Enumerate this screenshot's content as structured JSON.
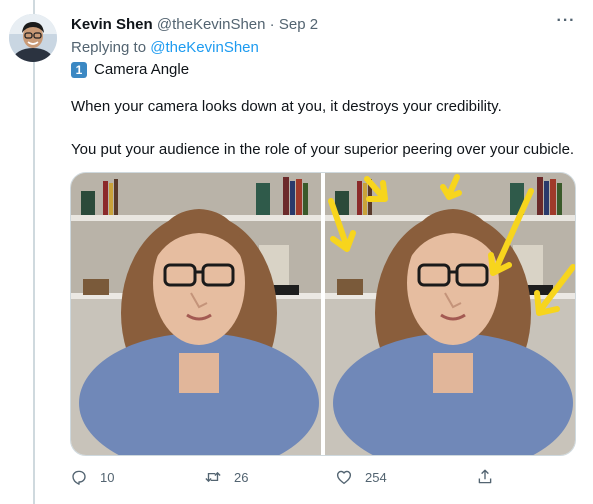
{
  "tweet": {
    "author_name": "Kevin Shen",
    "handle": "@theKevinShen",
    "separator": "·",
    "date": "Sep 2",
    "more_label": "···",
    "replying_prefix": "Replying to",
    "replying_to": "@theKevinShen",
    "keycap_emoji": "1",
    "title_line": "Camera Angle",
    "paragraph_1": "When your camera looks down at you, it destroys your credibility.",
    "paragraph_2": "You put your audience in the role of your superior peering over your cubicle."
  },
  "actions": {
    "reply_count": "10",
    "retweet_count": "26",
    "like_count": "254"
  },
  "colors": {
    "accent": "#1d9bf0",
    "muted": "#536471",
    "arrow_yellow": "#f7d51d"
  },
  "icons": [
    "reply-icon",
    "retweet-icon",
    "like-icon",
    "share-icon",
    "more-icon"
  ]
}
